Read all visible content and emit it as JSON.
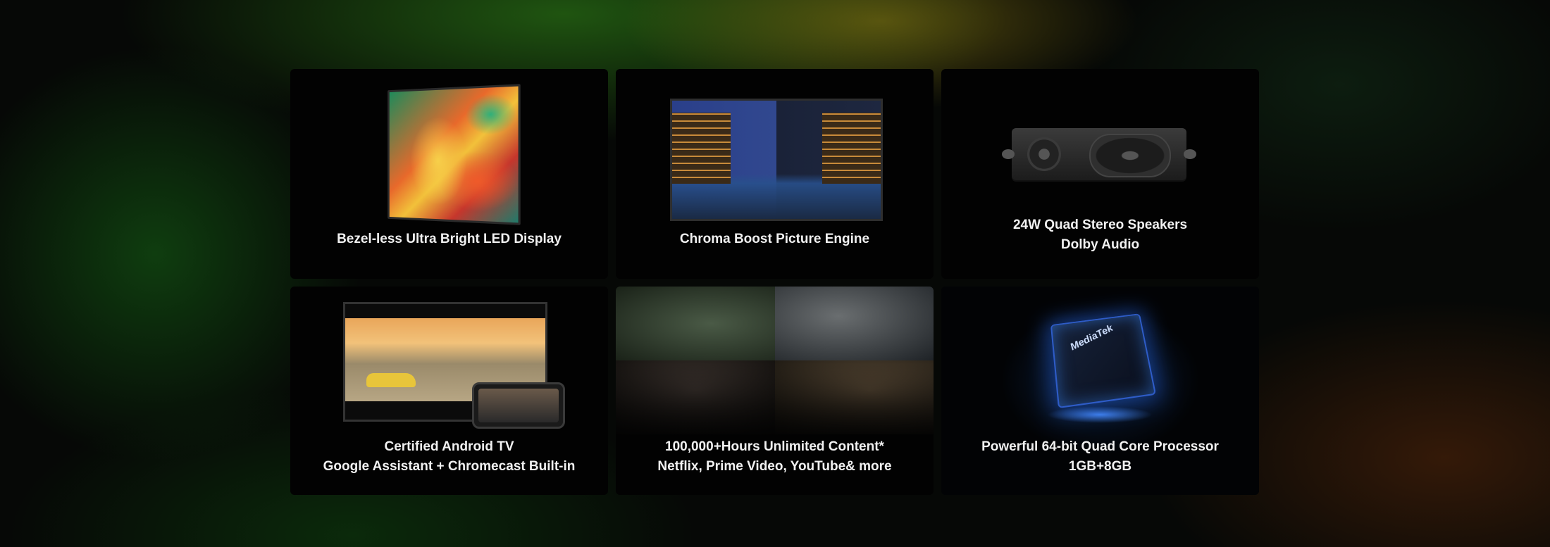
{
  "features": [
    {
      "lines": [
        "Bezel-less Ultra Bright LED Display"
      ]
    },
    {
      "lines": [
        "Chroma Boost Picture Engine"
      ]
    },
    {
      "lines": [
        "24W Quad Stereo Speakers",
        "Dolby Audio"
      ]
    },
    {
      "lines": [
        "Certified Android TV",
        "Google Assistant + Chromecast Built-in"
      ]
    },
    {
      "lines": [
        "100,000+Hours Unlimited Content*",
        "Netflix, Prime Video, YouTube& more"
      ]
    },
    {
      "lines": [
        "Powerful 64-bit Quad Core Processor",
        "1GB+8GB"
      ]
    }
  ],
  "chip_brand": "MediaTek"
}
